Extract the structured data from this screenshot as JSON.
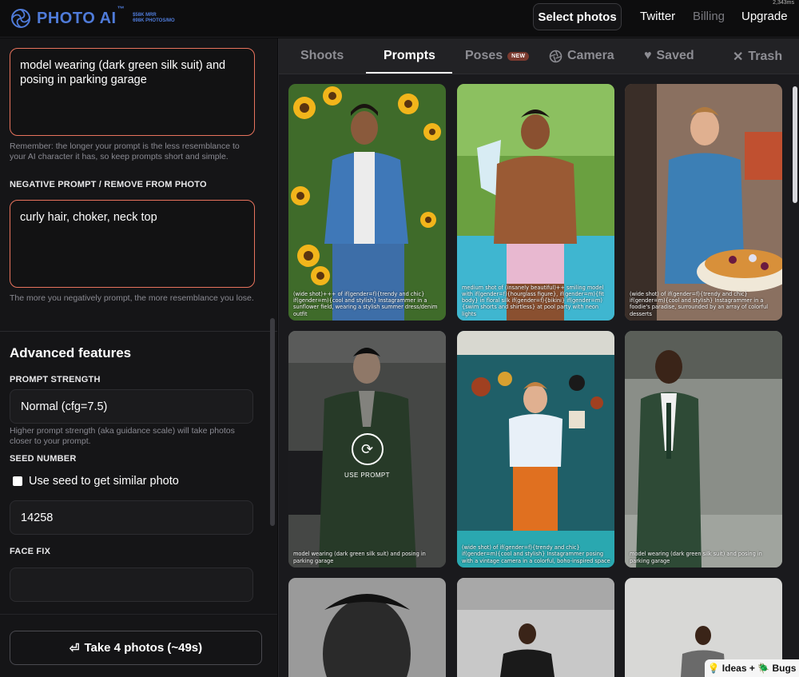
{
  "header": {
    "logo_text": "PHOTO AI",
    "logo_tm": "™",
    "stat_mrr": "$58K MRR",
    "stat_photos": "698K PHOTOS/MO",
    "corner_count": "2,343ms",
    "select_photos": "Select photos",
    "twitter": "Twitter",
    "billing": "Billing",
    "upgrade": "Upgrade"
  },
  "sidebar": {
    "prompt_value": "model wearing (dark green silk suit) and posing in parking garage",
    "prompt_help": "Remember: the longer your prompt is the less resemblance to your AI character it has, so keep prompts short and simple.",
    "negative_label": "NEGATIVE PROMPT / REMOVE FROM PHOTO",
    "negative_value": "curly hair, choker, neck top",
    "negative_help": "The more you negatively prompt, the more resemblance you lose.",
    "advanced_title": "Advanced features",
    "strength_label": "PROMPT STRENGTH",
    "strength_value": "Normal (cfg=7.5)",
    "strength_help": "Higher prompt strength (aka guidance scale) will take photos closer to your prompt.",
    "seed_label": "SEED NUMBER",
    "seed_checkbox_label": "Use seed to get similar photo",
    "seed_value": "14258",
    "face_fix_label": "FACE FIX",
    "face_fix_value": "",
    "take_button_icon": "⏎",
    "take_button": "Take 4 photos (~49s)"
  },
  "tabs": {
    "shoots": "Shoots",
    "prompts": "Prompts",
    "poses": "Poses",
    "poses_badge": "NEW",
    "camera": "Camera",
    "saved": "Saved",
    "trash": "Trash",
    "active": "Prompts"
  },
  "cards": [
    {
      "caption": "(wide shot)+++ of if(gender=f){trendy and chic} if(gender=m){cool and stylish} Instagrammer in a sunflower field, wearing a stylish summer dress/denim outfit"
    },
    {
      "caption": "medium shot of (insanely beautiful)++ smiling model with if(gender=f){hourglass figure}, if(gender=m){fit body} in floral silk if(gender=f){bikini} if(gender=m){swim shorts and shirtless} at pool party with neon lights"
    },
    {
      "caption": "(wide shot) of if(gender=f){trendy and chic} if(gender=m){cool and stylish} Instagrammer in a foodie's paradise, surrounded by an array of colorful desserts"
    },
    {
      "caption": "model wearing (dark green silk suit) and posing in parking garage",
      "overlay_label": "USE PROMPT"
    },
    {
      "caption": "(wide shot) of if(gender=f){trendy and chic} if(gender=m){cool and stylish} Instagrammer posing with a vintage camera in a colorful, boho-inspired space"
    },
    {
      "caption": "model wearing (dark green silk suit) and posing in parking garage"
    }
  ],
  "floating": {
    "ideas": "💡 Ideas + 🪲 Bugs"
  },
  "colors": {
    "accent_border": "#e8735d",
    "logo_blue": "#4f7bd9",
    "panel": "#151517"
  }
}
